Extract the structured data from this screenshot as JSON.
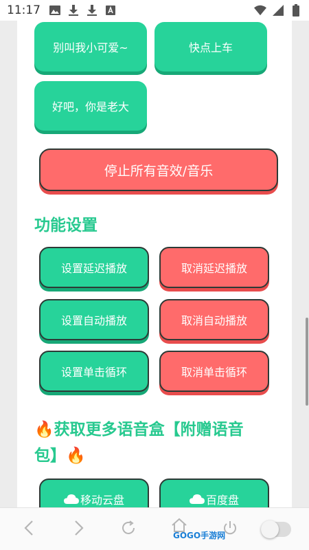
{
  "status_bar": {
    "time": "11:17",
    "left_icons": [
      "image-icon",
      "download-icon",
      "download-icon",
      "font-icon"
    ],
    "right_icons": [
      "wifi-icon",
      "signal-icon",
      "battery-icon"
    ]
  },
  "top_buttons": [
    {
      "label": "别叫我小可爱~"
    },
    {
      "label": "快点上车"
    },
    {
      "label": "好吧，你是老大"
    }
  ],
  "stop_button": {
    "label": "停止所有音效/音乐"
  },
  "settings": {
    "title": "功能设置",
    "buttons": [
      {
        "label": "设置延迟播放"
      },
      {
        "label": "取消延迟播放"
      },
      {
        "label": "设置自动播放"
      },
      {
        "label": "取消自动播放"
      },
      {
        "label": "设置单击循环"
      },
      {
        "label": "取消单击循环"
      }
    ]
  },
  "more": {
    "title_line1": "🔥获取更多语音盒【附赠语音",
    "title_line2": "包】🔥",
    "buttons": [
      {
        "label": "移动云盘",
        "icon": "cloud-icon"
      },
      {
        "label": "百度盘",
        "icon": "cloud-icon"
      }
    ]
  },
  "watermark": "GOGO手游网",
  "colors": {
    "green": "#27d39a",
    "red": "#ff6b6b",
    "title_green": "#27c98f"
  }
}
